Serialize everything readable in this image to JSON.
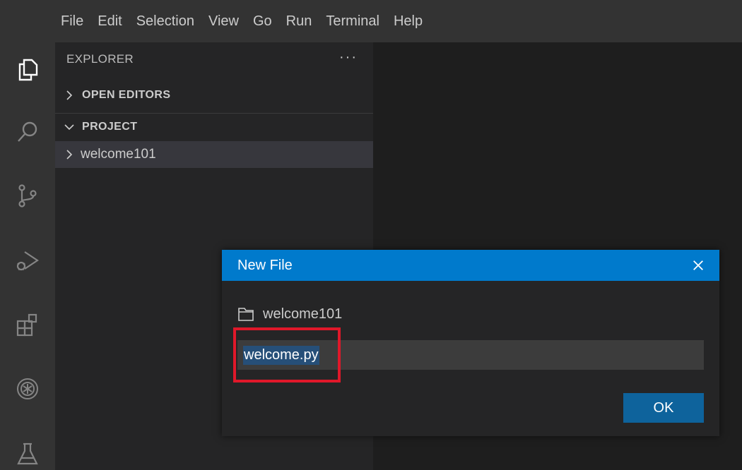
{
  "menubar": {
    "items": [
      "File",
      "Edit",
      "Selection",
      "View",
      "Go",
      "Run",
      "Terminal",
      "Help"
    ]
  },
  "activitybar": {
    "icons": [
      "explorer-icon",
      "search-icon",
      "source-control-icon",
      "run-debug-icon",
      "extensions-icon",
      "extension-badge-icon",
      "testing-icon"
    ]
  },
  "sidebar": {
    "title": "EXPLORER",
    "more_actions": "···",
    "sections": {
      "open_editors": "OPEN EDITORS",
      "project": "PROJECT"
    },
    "tree": {
      "folder": "welcome101"
    }
  },
  "dialog": {
    "title": "New File",
    "close": "×",
    "folder": "welcome101",
    "input_value": "welcome.py",
    "ok_label": "OK"
  },
  "colors": {
    "accent": "#007acc",
    "button": "#0e639c",
    "selection": "#264f78",
    "highlight": "#e0182a"
  }
}
